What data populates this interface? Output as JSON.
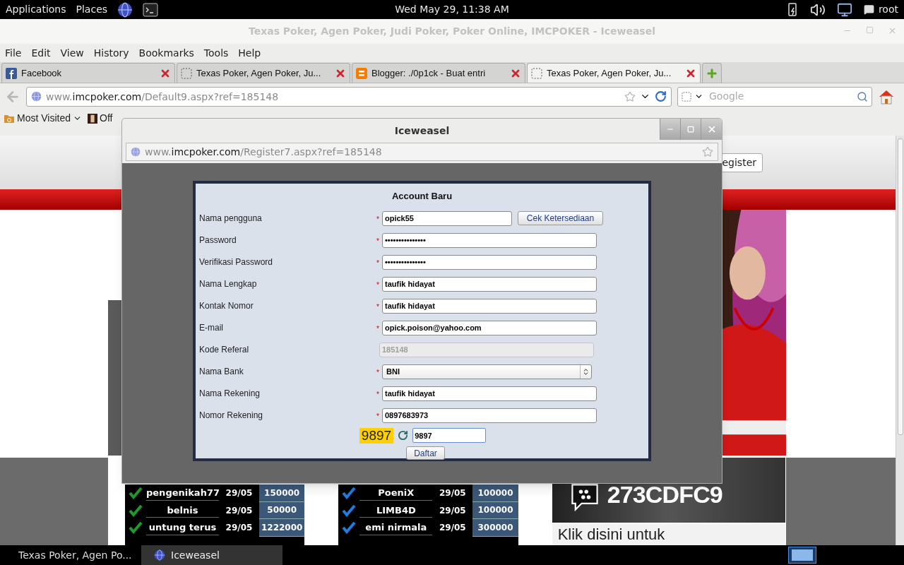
{
  "top_panel": {
    "menus": [
      "Applications",
      "Places"
    ],
    "clock": "Wed May 29, 11:38 AM",
    "user": "root"
  },
  "browser": {
    "title": "Texas Poker, Agen Poker, Judi Poker, Poker Online, IMCPOKER - Iceweasel",
    "menu": [
      "File",
      "Edit",
      "View",
      "History",
      "Bookmarks",
      "Tools",
      "Help"
    ],
    "tabs": [
      {
        "title": "Facebook",
        "kind": "social",
        "selected": false
      },
      {
        "title": "Texas Poker, Agen Poker, Ju...",
        "kind": "blank",
        "selected": false
      },
      {
        "title": "Blogger: ./0p1ck - Buat entri",
        "kind": "blog",
        "selected": false
      },
      {
        "title": "Texas Poker, Agen Poker, Ju...",
        "kind": "blank",
        "selected": true
      }
    ],
    "url": {
      "prefix": "www.",
      "domain": "imcpoker.com",
      "path": "/Default9.aspx?ref=185148"
    },
    "search": {
      "placeholder": "Google"
    },
    "bookmarks": [
      {
        "label": "Most Visited",
        "kind": "folder"
      },
      {
        "label": "Off",
        "kind": "site"
      }
    ]
  },
  "page": {
    "register_button": "egister",
    "tables": [
      {
        "color": "#1f9a2a",
        "rows": [
          [
            "pengenikah77",
            "29/05",
            "150000"
          ],
          [
            "belnis",
            "29/05",
            "50000"
          ],
          [
            "untung terus",
            "29/05",
            "1222000"
          ]
        ]
      },
      {
        "color": "#1e7de0",
        "rows": [
          [
            "PoeniX",
            "29/05",
            "100000"
          ],
          [
            "LIMB4D",
            "29/05",
            "100000"
          ],
          [
            "emi nirmala",
            "29/05",
            "300000"
          ]
        ]
      }
    ],
    "banner_code": "273CDFC9",
    "banner_text": "Klik disini untuk"
  },
  "popup": {
    "title": "Iceweasel",
    "url": {
      "prefix": "www.",
      "domain": "imcpoker.com",
      "path": "/Register7.aspx?ref=185148"
    },
    "form": {
      "title": "Account Baru",
      "required_mark": "*",
      "fields": [
        {
          "label": "Nama pengguna",
          "kind": "text",
          "value": "opick55",
          "required": true,
          "action": "Cek Ketersediaan"
        },
        {
          "label": "Password",
          "kind": "text",
          "value": "•••••••••••••••",
          "required": true
        },
        {
          "label": "Verifikasi Password",
          "kind": "text",
          "value": "•••••••••••••••",
          "required": true
        },
        {
          "label": "Nama Lengkap",
          "kind": "text",
          "value": "taufik hidayat",
          "required": true
        },
        {
          "label": "Kontak Nomor",
          "kind": "text",
          "value": "taufik hidayat",
          "required": true
        },
        {
          "label": "E-mail",
          "kind": "text",
          "value": "opick.poison@yahoo.com",
          "required": true
        },
        {
          "label": "Kode Referal",
          "kind": "disabled",
          "value": "185148",
          "required": false
        },
        {
          "label": "Nama Bank",
          "kind": "select",
          "value": "BNI",
          "required": true
        },
        {
          "label": "Nama Rekening",
          "kind": "text",
          "value": "taufik hidayat",
          "required": true
        },
        {
          "label": "Nomor Rekening",
          "kind": "text",
          "value": "0897683973",
          "required": true
        }
      ],
      "captcha": {
        "code": "9897",
        "value": "9897"
      },
      "submit": "Daftar"
    }
  },
  "taskbar": [
    {
      "label": "Texas Poker, Agen Po...",
      "selected": false
    },
    {
      "label": "Iceweasel",
      "selected": true
    }
  ]
}
